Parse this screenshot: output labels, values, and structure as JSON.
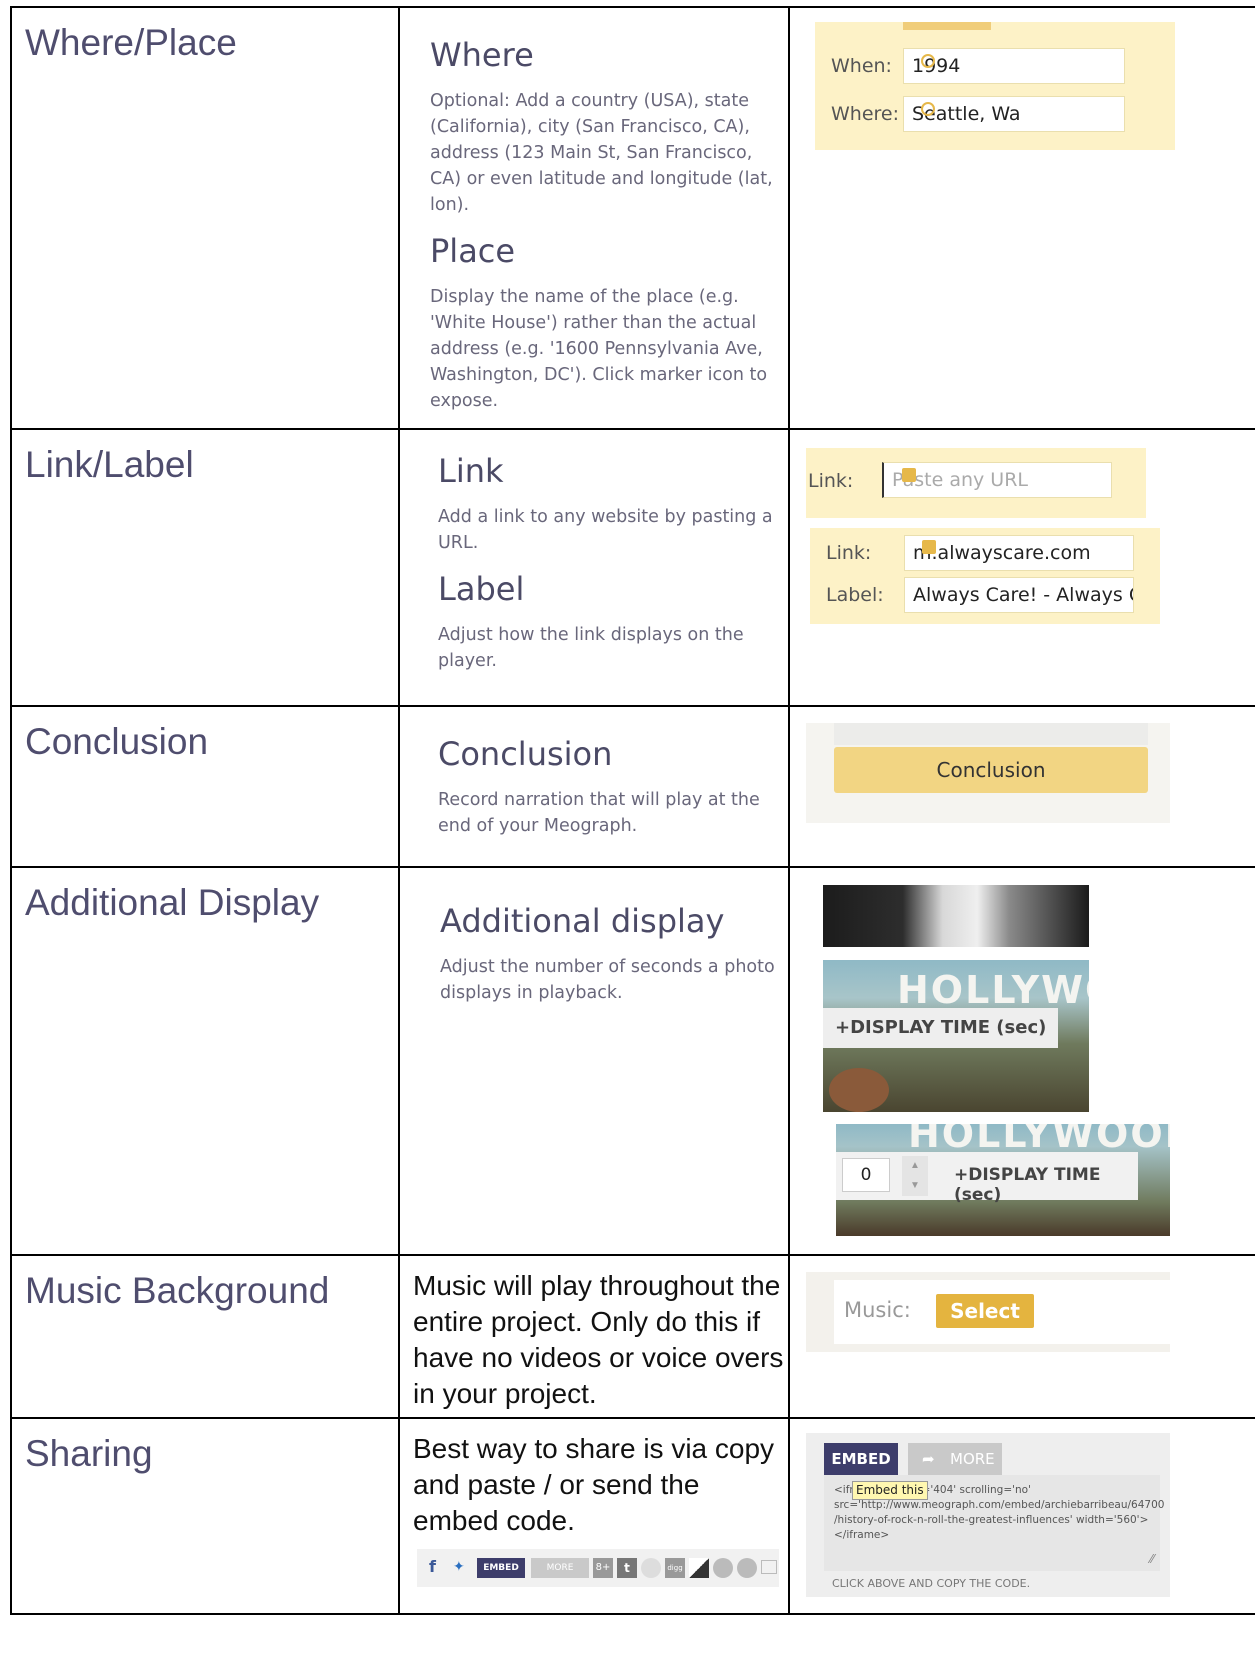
{
  "rows": [
    {
      "feature": "Where/Place",
      "desc": [
        {
          "heading": "Where",
          "text": "Optional: Add a country (USA), state (California), city (San Francisco, CA), address (123 Main St, San Francisco, CA) or even latitude and longitude (lat, lon)."
        },
        {
          "heading": "Place",
          "text": "Display the name of the place (e.g. 'White House') rather than the actual address (e.g. '1600 Pennsylvania Ave, Washington, DC'). Click marker icon to expose."
        }
      ],
      "shot": {
        "when_label": "When:",
        "when_value": "1994",
        "where_label": "Where:",
        "where_value": "Seattle, Wa"
      }
    },
    {
      "feature": "Link/Label",
      "desc": [
        {
          "heading": "Link",
          "text": "Add a link to any website by pasting a URL."
        },
        {
          "heading": "Label",
          "text": "Adjust how the link displays on the player."
        }
      ],
      "shot": {
        "link_label": "Link:",
        "link_placeholder": "Paste any URL",
        "link_label2": "Link:",
        "link_value": "m.alwayscare.com",
        "label_label": "Label:",
        "label_value": "Always Care! - Always Ca"
      }
    },
    {
      "feature": "Conclusion",
      "desc": [
        {
          "heading": "Conclusion",
          "text": "Record narration that will play at the end of your Meograph."
        }
      ],
      "shot": {
        "button": "Conclusion"
      }
    },
    {
      "feature": "Additional Display",
      "desc": [
        {
          "heading": "Additional display",
          "text": "Adjust the number of seconds a photo displays in playback."
        }
      ],
      "shot": {
        "sign": "HOLLYWO",
        "sign2": "HOLLYWOOD",
        "chip": "+DISPLAY TIME (sec)",
        "stepper_value": "0",
        "chip2": "+DISPLAY TIME (sec)"
      }
    },
    {
      "feature": "Music Background",
      "text": "Music will play throughout the entire project. Only do this if have no videos or voice overs in your project.",
      "shot": {
        "label": "Music:",
        "button": "Select"
      }
    },
    {
      "feature": "Sharing",
      "text": "Best way to share is via copy and paste /  or send the embed code.",
      "share_bar": {
        "embed": "EMBED",
        "more": "MORE",
        "gplus": "8+",
        "tumblr": "t",
        "digg": "digg"
      },
      "shot": {
        "embed_tab": "EMBED",
        "more_tab": "MORE",
        "tooltip": "Embed this",
        "code_lines": [
          "<ifra      ='0' height='404' scrolling='no'",
          "src='http://www.meograph.com/embed/archiebarribeau/64700",
          "/history-of-rock-n-roll-the-greatest-influences' width='560'>",
          "</iframe>"
        ],
        "instruction": "CLICK ABOVE AND COPY THE CODE."
      }
    }
  ],
  "colors": {
    "accent_yellow": "#f0cd7a",
    "field_yellow": "#fdf2c7",
    "select_gold": "#e4b43f",
    "embed_navy": "#3d3d6b",
    "heading_purple": "#4f4d6e"
  }
}
